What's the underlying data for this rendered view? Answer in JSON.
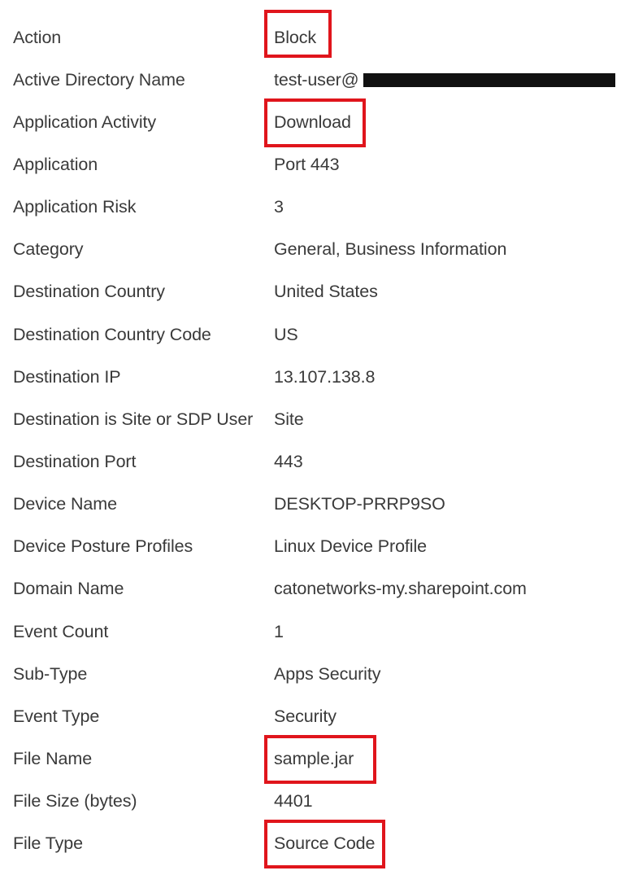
{
  "rows": [
    {
      "label": "Action",
      "value": "Block"
    },
    {
      "label": "Active Directory Name",
      "value": "test-user@"
    },
    {
      "label": "Application Activity",
      "value": "Download"
    },
    {
      "label": "Application",
      "value": "Port 443"
    },
    {
      "label": "Application Risk",
      "value": "3"
    },
    {
      "label": "Category",
      "value": "General, Business Information"
    },
    {
      "label": "Destination Country",
      "value": "United States"
    },
    {
      "label": "Destination Country Code",
      "value": "US"
    },
    {
      "label": "Destination IP",
      "value": "13.107.138.8"
    },
    {
      "label": "Destination is Site or SDP User",
      "value": "Site"
    },
    {
      "label": "Destination Port",
      "value": "443"
    },
    {
      "label": "Device Name",
      "value": "DESKTOP-PRRP9SO"
    },
    {
      "label": "Device Posture Profiles",
      "value": "Linux Device Profile"
    },
    {
      "label": "Domain Name",
      "value": "catonetworks-my.sharepoint.com"
    },
    {
      "label": "Event Count",
      "value": "1"
    },
    {
      "label": "Sub-Type",
      "value": "Apps Security"
    },
    {
      "label": "Event Type",
      "value": "Security"
    },
    {
      "label": "File Name",
      "value": "sample.jar"
    },
    {
      "label": "File Size (bytes)",
      "value": "4401"
    },
    {
      "label": "File Type",
      "value": "Source Code"
    }
  ],
  "highlight_color": "#e0151c"
}
